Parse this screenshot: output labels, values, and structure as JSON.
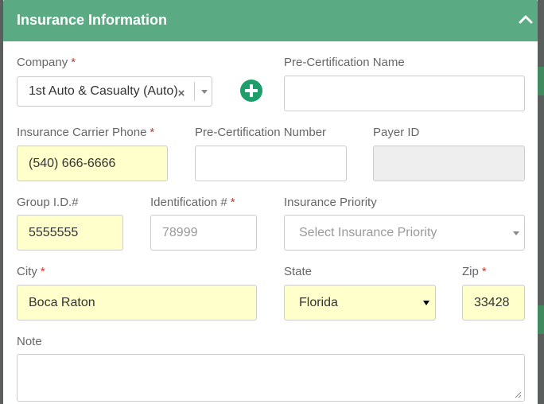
{
  "panel": {
    "title": "Insurance Information",
    "header_color": "#5aaa84"
  },
  "icons": {
    "collapse": "chevron-up-icon",
    "add": "plus-circle-icon",
    "clear": "close-icon"
  },
  "company": {
    "label": "Company",
    "required_mark": "*",
    "value": "1st Auto & Casualty (Auto)",
    "clear_glyph": "×"
  },
  "pre_cert_name": {
    "label": "Pre-Certification Name",
    "value": ""
  },
  "carrier_phone": {
    "label": "Insurance Carrier Phone",
    "required_mark": "*",
    "value": "(540) 666-6666"
  },
  "pre_cert_number": {
    "label": "Pre-Certification Number",
    "value": ""
  },
  "payer_id": {
    "label": "Payer ID",
    "value": ""
  },
  "group_id": {
    "label": "Group I.D.#",
    "value": "5555555"
  },
  "identification": {
    "label": "Identification #",
    "required_mark": "*",
    "placeholder": "78999"
  },
  "priority": {
    "label": "Insurance Priority",
    "placeholder": "Select Insurance Priority"
  },
  "city": {
    "label": "City",
    "required_mark": "*",
    "value": "Boca Raton"
  },
  "state": {
    "label": "State",
    "value": "Florida"
  },
  "zip": {
    "label": "Zip",
    "required_mark": "*",
    "value": "33428"
  },
  "note": {
    "label": "Note",
    "value": ""
  },
  "colors": {
    "required_field_bg": "#ffffcc",
    "disabled_bg": "#eeeeee",
    "required_star": "#c0392b",
    "add_button": "#1e9e6a"
  }
}
